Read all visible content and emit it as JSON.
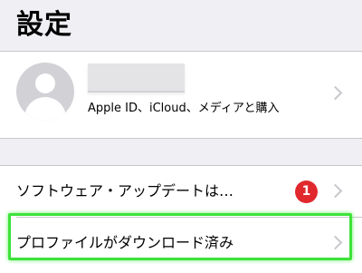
{
  "header": {
    "title": "設定"
  },
  "profile": {
    "subtitle": "Apple ID、iCloud、メディアと購入",
    "avatar_icon": "person-silhouette-icon"
  },
  "settings": {
    "software_update": {
      "label": "ソフトウェア・アップデートは…",
      "badge_count": "1"
    },
    "profile_downloaded": {
      "label": "プロファイルがダウンロード済み"
    }
  },
  "colors": {
    "background": "#efeff4",
    "badge": "#e0282d",
    "highlight": "#3ee23a"
  }
}
